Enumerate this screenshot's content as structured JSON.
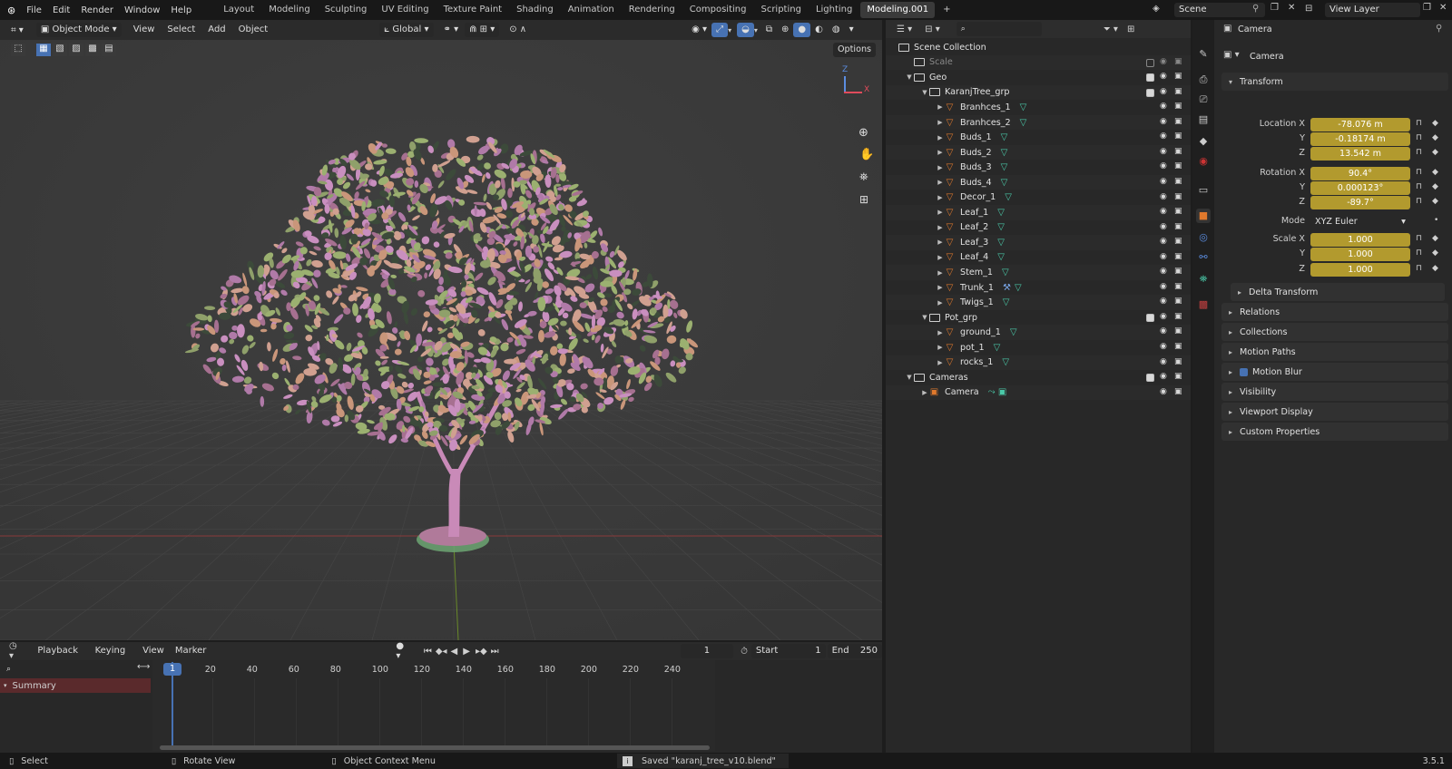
{
  "topbar": {
    "menus": [
      "File",
      "Edit",
      "Render",
      "Window",
      "Help"
    ],
    "workspaces": [
      "Layout",
      "Modeling",
      "Sculpting",
      "UV Editing",
      "Texture Paint",
      "Shading",
      "Animation",
      "Rendering",
      "Compositing",
      "Scripting",
      "Lighting",
      "Modeling.001"
    ],
    "active_workspace": "Modeling.001",
    "add_tab": "+",
    "scene": "Scene",
    "view_layer": "View Layer"
  },
  "viewport": {
    "mode": "Object Mode",
    "menus": [
      "View",
      "Select",
      "Add",
      "Object"
    ],
    "transform_orientation": "Global",
    "options": "Options",
    "gizmo": {
      "z": "Z",
      "x": "X"
    }
  },
  "outliner": {
    "rows": [
      {
        "label": "Scene Collection",
        "type": "scene",
        "level": 0
      },
      {
        "label": "Scale",
        "type": "collection",
        "level": 1,
        "dim": true,
        "check": false
      },
      {
        "label": "Geo",
        "type": "collection",
        "level": 1,
        "expanded": true,
        "check": true
      },
      {
        "label": "KaranjTree_grp",
        "type": "collection",
        "level": 2,
        "expanded": true,
        "check": true
      },
      {
        "label": "Branhces_1",
        "type": "mesh",
        "level": 3
      },
      {
        "label": "Branhces_2",
        "type": "mesh",
        "level": 3
      },
      {
        "label": "Buds_1",
        "type": "mesh",
        "level": 3
      },
      {
        "label": "Buds_2",
        "type": "mesh",
        "level": 3
      },
      {
        "label": "Buds_3",
        "type": "mesh",
        "level": 3
      },
      {
        "label": "Buds_4",
        "type": "mesh",
        "level": 3
      },
      {
        "label": "Decor_1",
        "type": "mesh",
        "level": 3
      },
      {
        "label": "Leaf_1",
        "type": "mesh",
        "level": 3
      },
      {
        "label": "Leaf_2",
        "type": "mesh",
        "level": 3
      },
      {
        "label": "Leaf_3",
        "type": "mesh",
        "level": 3
      },
      {
        "label": "Leaf_4",
        "type": "mesh",
        "level": 3
      },
      {
        "label": "Stem_1",
        "type": "mesh",
        "level": 3
      },
      {
        "label": "Trunk_1",
        "type": "mesh",
        "level": 3,
        "modifier": true
      },
      {
        "label": "Twigs_1",
        "type": "mesh",
        "level": 3
      },
      {
        "label": "Pot_grp",
        "type": "collection",
        "level": 2,
        "expanded": true,
        "check": true
      },
      {
        "label": "ground_1",
        "type": "mesh",
        "level": 3
      },
      {
        "label": "pot_1",
        "type": "mesh",
        "level": 3
      },
      {
        "label": "rocks_1",
        "type": "mesh",
        "level": 3
      },
      {
        "label": "Cameras",
        "type": "collection",
        "level": 1,
        "expanded": true,
        "check": true
      },
      {
        "label": "Camera",
        "type": "camera",
        "level": 2
      }
    ]
  },
  "properties": {
    "object_name": "Camera",
    "data_name": "Camera",
    "transform_title": "Transform",
    "location": {
      "label": "Location X",
      "x": "-78.076 m",
      "y": "-0.18174 m",
      "z": "13.542 m"
    },
    "rotation": {
      "label": "Rotation X",
      "x": "90.4°",
      "y": "0.000123°",
      "z": "-89.7°"
    },
    "mode_label": "Mode",
    "mode_value": "XYZ Euler",
    "scale": {
      "label": "Scale X",
      "x": "1.000",
      "y": "1.000",
      "z": "1.000"
    },
    "axis_y": "Y",
    "axis_z": "Z",
    "delta": "Delta Transform",
    "panels": [
      "Relations",
      "Collections",
      "Motion Paths",
      "Motion Blur",
      "Visibility",
      "Viewport Display",
      "Custom Properties"
    ]
  },
  "timeline": {
    "menus": [
      "Playback",
      "Keying",
      "View",
      "Marker"
    ],
    "current_frame": "1",
    "start_label": "Start",
    "start": "1",
    "end_label": "End",
    "end": "250",
    "ticks": [
      "1",
      "20",
      "40",
      "60",
      "80",
      "100",
      "120",
      "140",
      "160",
      "180",
      "200",
      "220",
      "240"
    ],
    "summary": "Summary"
  },
  "status": {
    "select": "Select",
    "rotate": "Rotate View",
    "context": "Object Context Menu",
    "message": "Saved \"karanj_tree_v10.blend\"",
    "version": "3.5.1"
  },
  "colors": {
    "accent": "#b29a2e",
    "mesh_icon": "#e0792c",
    "vgroup": "#4ac9a8",
    "frame": "#4772b3"
  }
}
